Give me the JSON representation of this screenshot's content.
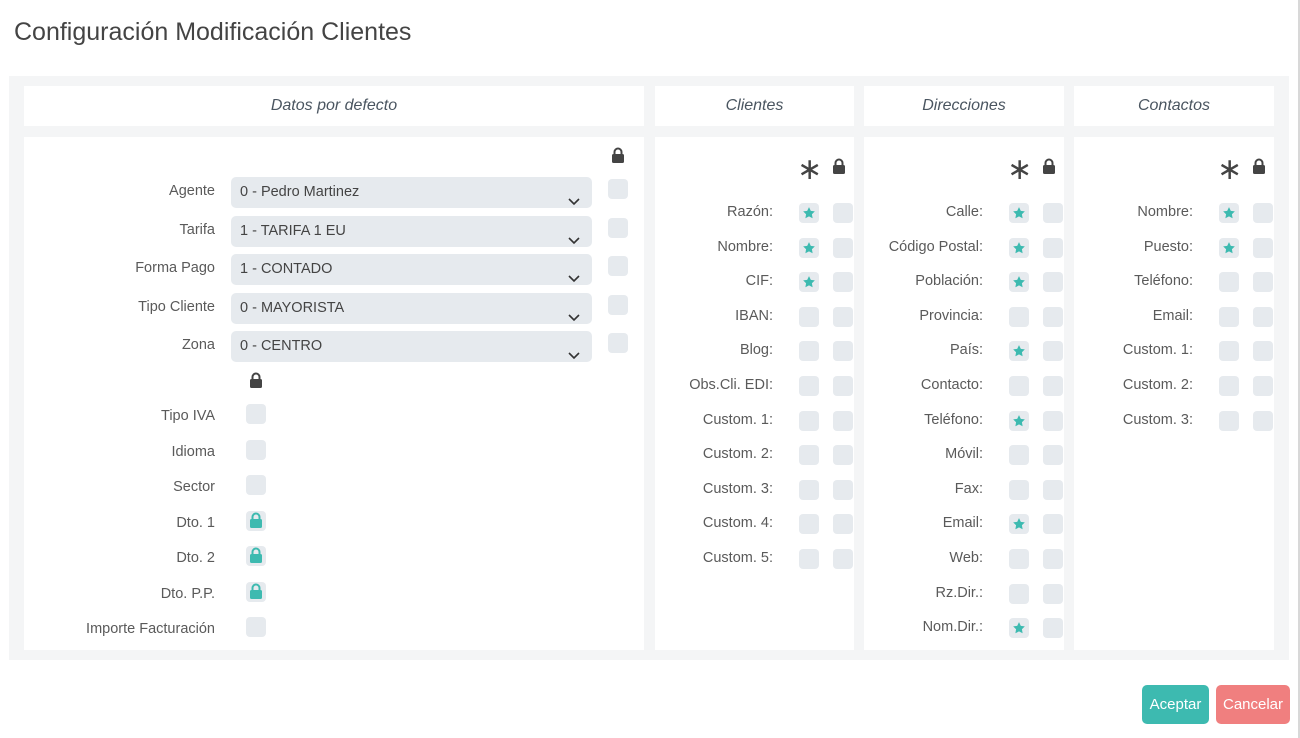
{
  "title": "Configuración Modificación Clientes",
  "colors": {
    "accent": "#3dbab0",
    "cancel": "#f07f7f",
    "field_bg": "#e6eaee"
  },
  "headers": {
    "datos": "Datos por defecto",
    "clientes": "Clientes",
    "direcciones": "Direcciones",
    "contactos": "Contactos"
  },
  "defaults": {
    "selects": [
      {
        "label": "Agente",
        "value": "0 - Pedro Martinez"
      },
      {
        "label": "Tarifa",
        "value": "1 - TARIFA 1 EU"
      },
      {
        "label": "Forma Pago",
        "value": "1 - CONTADO"
      },
      {
        "label": "Tipo Cliente",
        "value": "0 - MAYORISTA"
      },
      {
        "label": "Zona",
        "value": "0 - CENTRO"
      }
    ],
    "locked_fields": [
      {
        "label": "Tipo IVA",
        "locked": false
      },
      {
        "label": "Idioma",
        "locked": false
      },
      {
        "label": "Sector",
        "locked": false
      },
      {
        "label": "Dto. 1",
        "locked": true
      },
      {
        "label": "Dto. 2",
        "locked": true
      },
      {
        "label": "Dto. P.P.",
        "locked": true
      },
      {
        "label": "Importe Facturación",
        "locked": false
      }
    ]
  },
  "clientes": [
    {
      "label": "Razón:",
      "required": true
    },
    {
      "label": "Nombre:",
      "required": true
    },
    {
      "label": "CIF:",
      "required": true
    },
    {
      "label": "IBAN:",
      "required": false
    },
    {
      "label": "Blog:",
      "required": false
    },
    {
      "label": "Obs.Cli. EDI:",
      "required": false
    },
    {
      "label": "Custom. 1:",
      "required": false
    },
    {
      "label": "Custom. 2:",
      "required": false
    },
    {
      "label": "Custom. 3:",
      "required": false
    },
    {
      "label": "Custom. 4:",
      "required": false
    },
    {
      "label": "Custom. 5:",
      "required": false
    }
  ],
  "direcciones": [
    {
      "label": "Calle:",
      "required": true
    },
    {
      "label": "Código Postal:",
      "required": true
    },
    {
      "label": "Población:",
      "required": true
    },
    {
      "label": "Provincia:",
      "required": false
    },
    {
      "label": "País:",
      "required": true
    },
    {
      "label": "Contacto:",
      "required": false
    },
    {
      "label": "Teléfono:",
      "required": true
    },
    {
      "label": "Móvil:",
      "required": false
    },
    {
      "label": "Fax:",
      "required": false
    },
    {
      "label": "Email:",
      "required": true
    },
    {
      "label": "Web:",
      "required": false
    },
    {
      "label": "Rz.Dir.:",
      "required": false
    },
    {
      "label": "Nom.Dir.:",
      "required": true
    }
  ],
  "contactos": [
    {
      "label": "Nombre:",
      "required": true
    },
    {
      "label": "Puesto:",
      "required": true
    },
    {
      "label": "Teléfono:",
      "required": false
    },
    {
      "label": "Email:",
      "required": false
    },
    {
      "label": "Custom. 1:",
      "required": false
    },
    {
      "label": "Custom. 2:",
      "required": false
    },
    {
      "label": "Custom. 3:",
      "required": false
    }
  ],
  "buttons": {
    "accept": "Aceptar",
    "cancel": "Cancelar"
  }
}
